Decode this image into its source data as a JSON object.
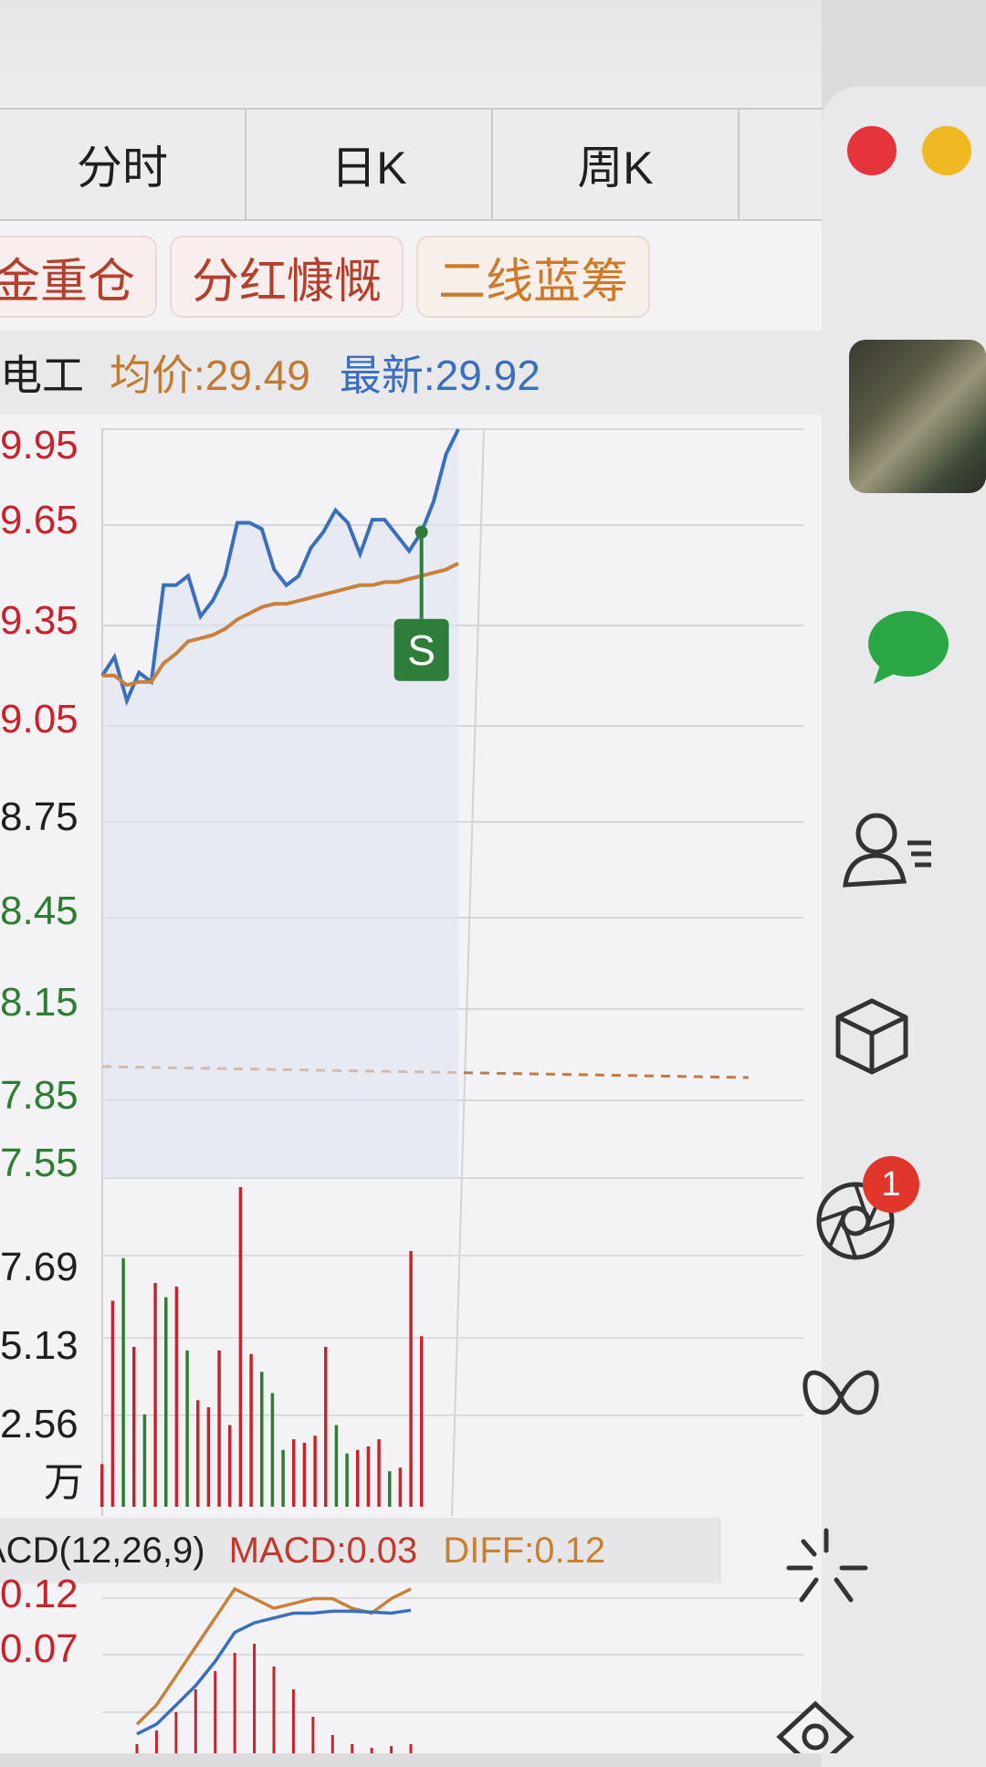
{
  "tabs": [
    "分时",
    "日K",
    "周K"
  ],
  "tags": [
    "金重仓",
    "分红慷慨",
    "二线蓝筹"
  ],
  "info": {
    "name": "电工",
    "avg_label": "均价:29.49",
    "last_label": "最新:29.92"
  },
  "price_axis": {
    "upper": [
      "9.95",
      "9.65",
      "9.35",
      "9.05"
    ],
    "middle": "8.75",
    "lower": [
      "8.45",
      "8.15",
      "7.85",
      "7.55"
    ]
  },
  "volume_axis": [
    "7.69",
    "5.13",
    "2.56",
    "万"
  ],
  "macd": {
    "name": "ACD(12,26,9)",
    "macd_label": "MACD:0.03",
    "diff_label": "DIFF:0.12",
    "axis": [
      "0.12",
      "0.07"
    ]
  },
  "marker": "S",
  "sidebar": {
    "badge": "1",
    "icons": [
      "chat-icon",
      "contacts-icon",
      "box-icon",
      "moments-icon",
      "butterfly-icon",
      "sparkle-icon",
      "compass-icon"
    ]
  },
  "colors": {
    "price_line": "#3a6fbf",
    "avg_line": "#c8803a",
    "up": "#c8232c",
    "down": "#2e7d32",
    "sell_marker": "#2f7d3a"
  },
  "chart_data": {
    "type": "line",
    "title": "",
    "x": [
      0,
      1,
      2,
      3,
      4,
      5,
      6,
      7,
      8,
      9,
      10,
      11,
      12,
      13,
      14,
      15,
      16,
      17,
      18,
      19,
      20,
      21,
      22,
      23,
      24,
      25,
      26,
      27,
      28,
      29,
      30,
      31,
      32,
      33,
      34,
      35
    ],
    "series": [
      {
        "values": [
          29.16,
          29.22,
          29.08,
          29.17,
          29.14,
          29.45,
          29.45,
          29.48,
          29.35,
          29.4,
          29.48,
          29.65,
          29.65,
          29.63,
          29.5,
          29.45,
          29.48,
          29.57,
          29.62,
          29.69,
          29.65,
          29.55,
          29.66,
          29.66,
          29.61,
          29.56,
          29.62,
          29.72,
          29.87,
          29.95
        ]
      },
      {
        "values": [
          29.16,
          29.16,
          29.13,
          29.14,
          29.14,
          29.2,
          29.23,
          29.27,
          29.28,
          29.29,
          29.31,
          29.34,
          29.36,
          29.38,
          29.39,
          29.39,
          29.4,
          29.41,
          29.42,
          29.43,
          29.44,
          29.45,
          29.45,
          29.46,
          29.46,
          29.47,
          29.48,
          29.49,
          29.5,
          29.52
        ]
      }
    ],
    "ylim": [
      27.55,
      29.95
    ],
    "volume": {
      "unit": "万",
      "ylim": [
        0,
        9.0
      ],
      "values": [
        1.2,
        5.8,
        7.0,
        4.5,
        2.6,
        6.3,
        5.9,
        6.2,
        4.4,
        3.0,
        2.8,
        4.4,
        2.3,
        9.0,
        4.3,
        3.8,
        3.2,
        1.6,
        1.9,
        1.8,
        2.0,
        4.5,
        2.3,
        1.5,
        1.6,
        1.7,
        1.9,
        1.0,
        1.1,
        7.2,
        4.8
      ],
      "colors": [
        "up",
        "up",
        "down",
        "up",
        "down",
        "up",
        "down",
        "up",
        "down",
        "up",
        "up",
        "up",
        "up",
        "up",
        "up",
        "down",
        "down",
        "down",
        "up",
        "up",
        "up",
        "up",
        "down",
        "down",
        "up",
        "up",
        "up",
        "down",
        "up",
        "up",
        "up"
      ]
    },
    "macd_series": [
      {
        "name": "DIFF",
        "values": [
          -0.02,
          0.0,
          0.03,
          0.06,
          0.09,
          0.12,
          0.11,
          0.1,
          0.105,
          0.11,
          0.11,
          0.1,
          0.095,
          0.11,
          0.12
        ]
      },
      {
        "name": "DEA",
        "values": [
          -0.03,
          -0.02,
          0.0,
          0.02,
          0.045,
          0.075,
          0.085,
          0.09,
          0.095,
          0.095,
          0.097,
          0.097,
          0.096,
          0.095,
          0.098
        ]
      }
    ],
    "sell_marker_index": 26
  }
}
